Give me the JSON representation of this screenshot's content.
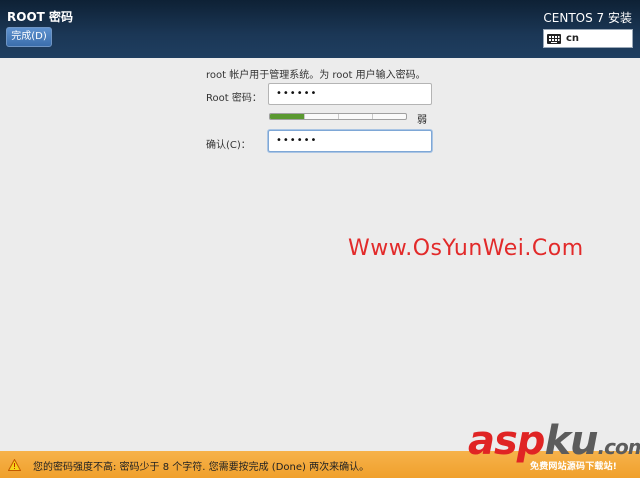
{
  "header": {
    "title": "ROOT 密码",
    "done_label": "完成(D)",
    "product_title": "CENTOS 7 安装",
    "keyboard_layout": "cn"
  },
  "form": {
    "info": "root 帐户用于管理系统。为 root 用户输入密码。",
    "root_password_label": "Root 密码：",
    "root_password_value": "••••••",
    "strength_label": "弱",
    "strength_fraction": 0.25,
    "confirm_label": "确认(C)：",
    "confirm_value": "••••••"
  },
  "watermark": "Www.OsYunWei.Com",
  "warning": {
    "text": "您的密码强度不高: 密码少于 8 个字符. 您需要按完成 (Done) 两次来确认。"
  },
  "logo": {
    "part1": "asp",
    "part2": "ku",
    "part3": ".com",
    "sub": "免费网站源码下载站!"
  },
  "colors": {
    "header": "#1b3756",
    "accent": "#3b6eac",
    "meter": "#5a9930",
    "warning": "#f0a02c",
    "watermark": "#e22a2a"
  }
}
